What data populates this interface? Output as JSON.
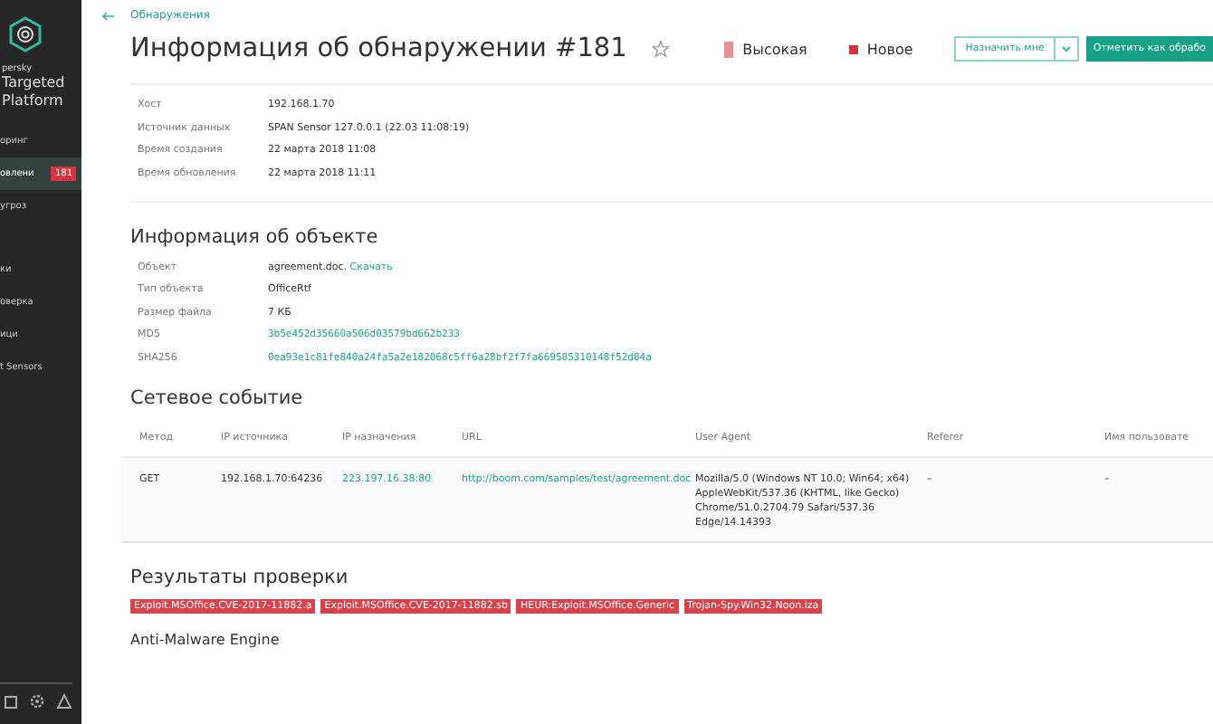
{
  "sidebar": {
    "brand": [
      "persky",
      "Targeted",
      "Platform"
    ],
    "items": [
      {
        "label": "оринг",
        "selected": false
      },
      {
        "label": "овлени",
        "selected": true,
        "badge": "181"
      },
      {
        "label": "угроз",
        "selected": false
      },
      {
        "label": "ки",
        "selected": false
      },
      {
        "label": "оверка",
        "selected": false
      },
      {
        "label": "ици",
        "selected": false
      },
      {
        "label": "t Sensors",
        "selected": false
      }
    ]
  },
  "breadcrumb": "Обнаружения",
  "title": "Информация об обнаружении #181",
  "severity": "Высокая",
  "status": "Новое",
  "assign_button": "Назначить мне",
  "mark_button": "Отметить как обрабо",
  "details": [
    {
      "label": "Хост",
      "value": "192.168.1.70"
    },
    {
      "label": "Источник данных",
      "value": "SPAN Sensor 127.0.0.1 (22.03 11:08:19)"
    },
    {
      "label": "Время создания",
      "value": "22 марта 2018 11:08"
    },
    {
      "label": "Время обновления",
      "value": "22 марта 2018 11:11"
    }
  ],
  "object_section": {
    "heading": "Информация об объекте",
    "rows": [
      {
        "label": "Объект",
        "value": "agreement.doc.",
        "link": "Скачать"
      },
      {
        "label": "Тип объекта",
        "value": "OfficeRtf"
      },
      {
        "label": "Размер файла",
        "value": "7 КБ"
      },
      {
        "label": "MD5",
        "link": "3b5e452d35660a506d03579bd662b233"
      },
      {
        "label": "SHA256",
        "link": "0ea93e1c81fe840a24fa5a2e182068c5ff6a28bf2f7fa669585310148f52d84a"
      }
    ]
  },
  "network_section": {
    "heading": "Сетевое событие",
    "columns": [
      "Метод",
      "IP источника",
      "IP назначения",
      "URL",
      "User Agent",
      "Referer",
      "Имя пользовате"
    ],
    "rows": [
      [
        "GET",
        "192.168.1.70:64236",
        "223.197.16.38:80",
        "http://boom.com/samples/test/agreement.doc",
        "Mozilla/5.0 (Windows NT 10.0; Win64; x64) AppleWebKit/537.36 (KHTML, like Gecko) Chrome/51.0.2704.79 Safari/537.36 Edge/14.14393",
        "–",
        "–"
      ]
    ]
  },
  "results_section": {
    "heading": "Результаты проверки",
    "tags": [
      "Exploit.MSOffice.CVE-2017-11882.a",
      "Exploit.MSOffice.CVE-2017-11882.sb",
      "HEUR:Exploit.MSOffice.Generic",
      "Trojan-Spy.Win32.Noon.iza"
    ],
    "engine": "Anti-Malware Engine"
  }
}
